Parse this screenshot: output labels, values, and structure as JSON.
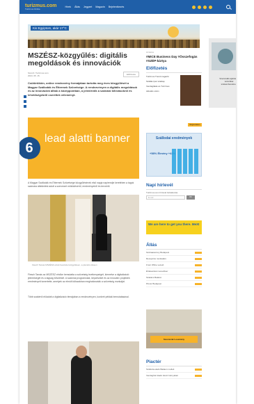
{
  "header": {
    "logo": "turizmus.com",
    "logo_tagline": "Turizmus Online",
    "nav": [
      "Hírek",
      "Állás",
      "Jegyzet",
      "Magazin",
      "Bejelentkezés"
    ]
  },
  "top_banner": {
    "text": "Kis Egyiptom, akár 17°C"
  },
  "article": {
    "title": "MSZÉSZ-közgyűlés: digitális megoldások és innovációk",
    "author": "Szerző: Turizmus.com",
    "date": "2024. 05. 15.",
    "date_button": "Előfizetés",
    "lead": "Csütörtökön, online rendezvény formájában tartotta meg éves közgyűlését a Magyar Szállodák és Éttermek Szövetsége. A rendezvényen a digitális megoldások és az innovációk álltak a középpontban, a jelenlévők a szakmai kihívásokról és lehetőségekről cseréltek véleményt.",
    "lead_banner": {
      "number": "6",
      "text": "lead alatti banner"
    },
    "para1": "A Magyar Szállodák és Éttermek Szövetsége közgyűlésének első napja napirendje keretében a tagok számára áttekintést adott a szervezet működéséről, eredményeiről és terveiről.",
    "caption1": "Flesch Tamás MSZÉSZ elnök beszéde közgyűlésen, a plenáris ülésen",
    "para2": "Flesch Tamás az MSZÉSZ elnöke bemutatta a szövetség tevékenységét, kiemelve a digitalizáció jelentőségét és a tagság bővülését. A szakmai programokat, képzéseket és az innovatív projektek eredményeit ismertette, amelyek az elmúlt időszakban meghatározták a szövetség munkáját.",
    "para3": "Több szakértő előadott a digitalizáció témájában a rendezvényen, konkrét példák bemutatásával."
  },
  "sidebar": {
    "ad_label": "Hirdetés",
    "headline": "#MICE Business Day #Összefogás #SZÉP-kártya",
    "subscribe_title": "Előfizetés",
    "subscribe_items": [
      "Turizmus Trend magazin",
      "Szállás Ipar szaklap",
      "Vendéglátás és Turizmus",
      "Aktuális szám"
    ],
    "subscribe_button": "Megrendelem",
    "blue_ad_title": "Szállodai eredmények",
    "blue_ad_pct": "+58% Élmény +43%",
    "newsletter_title": "Napi hírlevél",
    "newsletter_desc": "Turizmus.com hírlevél feliratkozás",
    "newsletter_placeholder": "E-mail",
    "newsletter_button": "OK",
    "yellow_text": "We are here to get you there. MeXI",
    "allas_title": "Állás",
    "allas_items": [
      "Szobaasszony Budapest",
      "Recepciós munkatárs",
      "Front Office vezető",
      "Értékesítési menedzser",
      "Szakács Balaton",
      "Pincér Budapest"
    ],
    "ad_photo_text": "Szezonzáró esemény",
    "piacter_title": "Piactér",
    "piacter_items": [
      "Szálloda eladó Balaton mellett",
      "Vendégház kiadó Hévíz környékén"
    ]
  },
  "skyscraper": {
    "text": "Szezonális ajánlatok turisztikai szakembereknek"
  }
}
